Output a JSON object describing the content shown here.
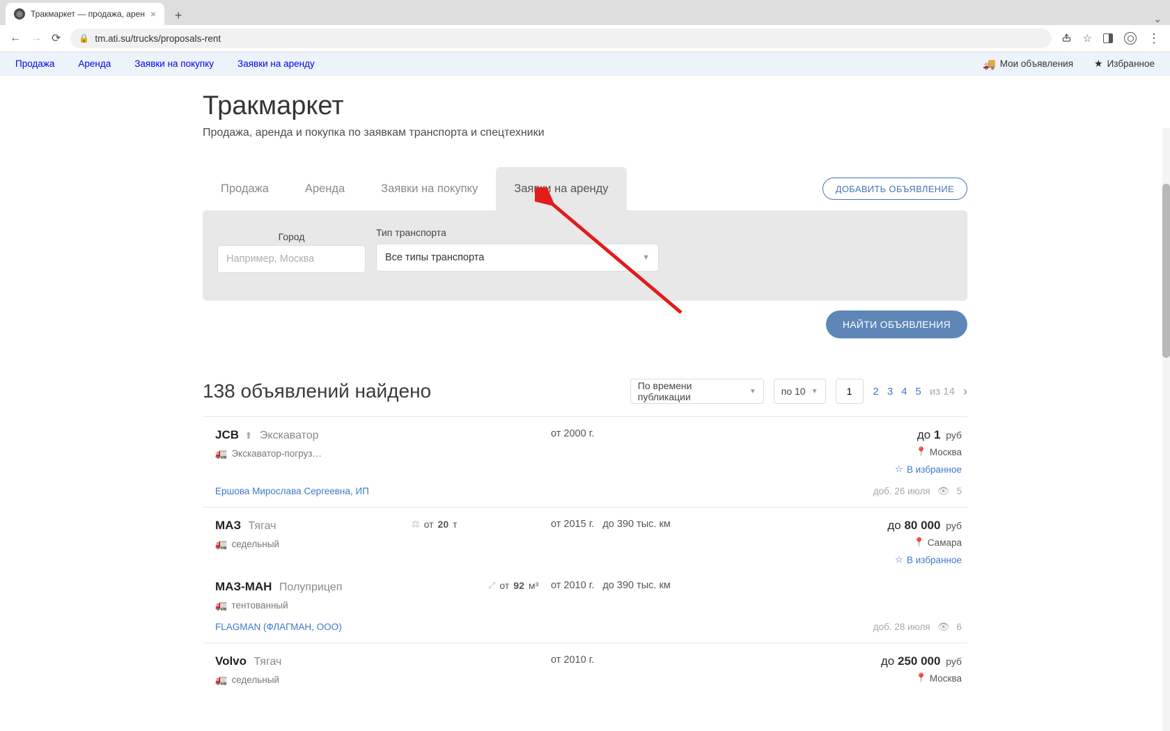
{
  "browser": {
    "tab_title": "Тракмаркет — продажа, арен",
    "url": "tm.ati.su/trucks/proposals-rent"
  },
  "sitenav": {
    "left": [
      "Продажа",
      "Аренда",
      "Заявки на покупку",
      "Заявки на аренду"
    ],
    "my_ads": "Мои объявления",
    "fav": "Избранное"
  },
  "header": {
    "title": "Тракмаркет",
    "subtitle": "Продажа, аренда и покупка по заявкам транспорта и спецтехники"
  },
  "tabs": {
    "items": [
      "Продажа",
      "Аренда",
      "Заявки на покупку",
      "Заявки на аренду"
    ],
    "active_index": 3,
    "add_button": "ДОБАВИТЬ ОБЪЯВЛЕНИЕ"
  },
  "filter": {
    "city_label": "Город",
    "city_placeholder": "Например, Москва",
    "type_label": "Тип транспорта",
    "type_value": "Все типы транспорта",
    "find_button": "НАЙТИ ОБЪЯВЛЕНИЯ"
  },
  "results": {
    "count_text": "138 объявлений найдено",
    "sort_value": "По времени публикации",
    "per_page": "по 10",
    "page_input": "1",
    "pages": [
      "2",
      "3",
      "4",
      "5"
    ],
    "of_label": "из 14"
  },
  "listings": [
    {
      "brand": "JCB",
      "uploaded": true,
      "kind": "Экскаватор",
      "body": "Экскаватор-погруз…",
      "year": "от 2000 г.",
      "mileage": "",
      "weight_from": "",
      "weight_unit": "",
      "price_prefix": "до",
      "price": "1",
      "currency": "руб",
      "city": "Москва",
      "fav": "В избранное",
      "owner": "Ершова Мирослава Сергеевна, ИП",
      "added": "доб. 26 июля",
      "views": "5"
    },
    {
      "brand": "МАЗ",
      "uploaded": false,
      "kind": "Тягач",
      "body": "седельный",
      "year": "от 2015 г.",
      "mileage": "до 390 тыс. км",
      "weight_from": "от",
      "weight_num": "20",
      "weight_unit": "т",
      "price_prefix": "до",
      "price": "80 000",
      "currency": "руб",
      "city": "Самара",
      "fav": "В избранное",
      "second": {
        "brand": "МАЗ-МАН",
        "kind": "Полуприцеп",
        "body": "тентованный",
        "year": "от 2010 г.",
        "mileage": "до 390 тыс. км",
        "vol_from": "от",
        "vol_num": "92",
        "vol_unit": "м³"
      },
      "owner": "FLAGMAN (ФЛАГМАН, ООО)",
      "added": "доб. 28 июля",
      "views": "6"
    },
    {
      "brand": "Volvo",
      "uploaded": false,
      "kind": "Тягач",
      "body": "седельный",
      "year": "от 2010 г.",
      "mileage": "",
      "price_prefix": "до",
      "price": "250 000",
      "currency": "руб",
      "city": "Москва"
    }
  ]
}
